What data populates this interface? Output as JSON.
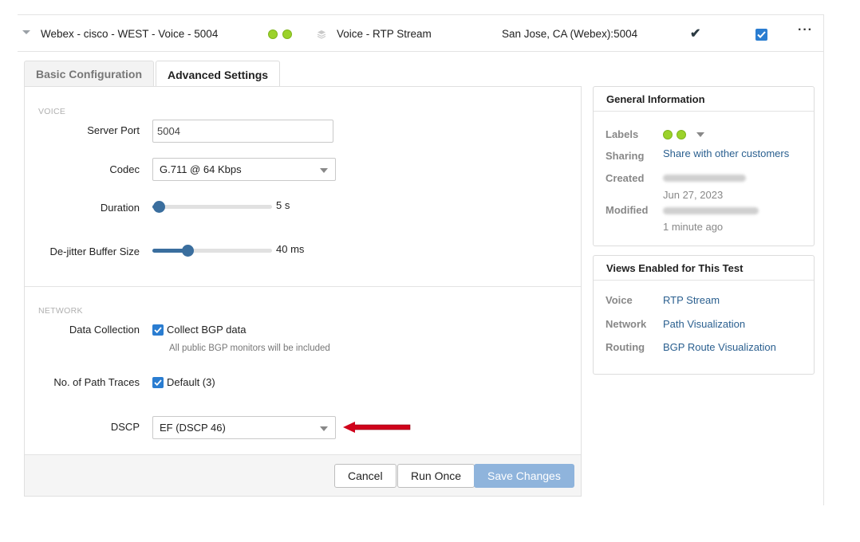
{
  "test_row": {
    "name": "Webex - cisco - WEST - Voice - 5004",
    "type": "Voice - RTP Stream",
    "agent": "San Jose, CA (Webex):5004",
    "more": "···"
  },
  "tabs": [
    {
      "label": "Basic Configuration",
      "active": false
    },
    {
      "label": "Advanced Settings",
      "active": true
    }
  ],
  "voice": {
    "section_label": "VOICE",
    "server_port_label": "Server Port",
    "server_port_value": "5004",
    "codec_label": "Codec",
    "codec_value": "G.711 @ 64 Kbps",
    "duration_label": "Duration",
    "duration_value": "5 s",
    "duration_fraction": 0.05,
    "dejitter_label": "De-jitter Buffer Size",
    "dejitter_value": "40 ms",
    "dejitter_fraction": 0.29
  },
  "network": {
    "section_label": "NETWORK",
    "data_collection_label": "Data Collection",
    "collect_bgp_label": "Collect BGP data",
    "collect_bgp_hint": "All public BGP monitors will be included",
    "path_traces_label": "No. of Path Traces",
    "path_traces_value": "Default (3)",
    "dscp_label": "DSCP",
    "dscp_value": "EF (DSCP 46)"
  },
  "buttons": {
    "cancel": "Cancel",
    "run_once": "Run Once",
    "save": "Save Changes"
  },
  "general_info": {
    "title": "General Information",
    "labels_label": "Labels",
    "sharing_label": "Sharing",
    "sharing_value": "Share with other customers",
    "created_label": "Created",
    "created_date": "Jun 27, 2023",
    "modified_label": "Modified",
    "modified_time": "1 minute ago"
  },
  "views": {
    "title": "Views Enabled for This Test",
    "items": [
      {
        "label": "Voice",
        "value": "RTP Stream"
      },
      {
        "label": "Network",
        "value": "Path Visualization"
      },
      {
        "label": "Routing",
        "value": "BGP Route Visualization"
      }
    ]
  },
  "colors": {
    "accent": "#2a7dd1",
    "slider": "#3a6e9e",
    "label_dot": "#9bd22a",
    "link": "#2a5f8f",
    "annotation_arrow": "#d0021b",
    "primary_button": "#8fb4dc"
  }
}
